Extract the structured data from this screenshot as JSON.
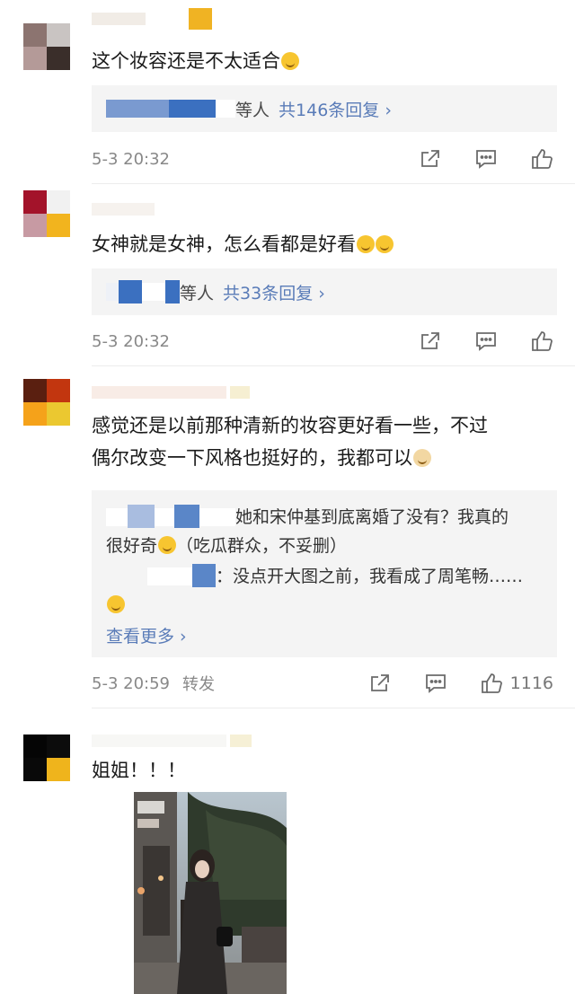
{
  "comments": [
    {
      "text": "这个妆容还是不太适合",
      "reply_suffix": "等人",
      "reply_link": "共146条回复 ›",
      "time": "5-3 20:32"
    },
    {
      "text": "女神就是女神，怎么看都是好看",
      "reply_suffix": "等人",
      "reply_link": "共33条回复 ›",
      "time": "5-3 20:32"
    },
    {
      "text_line1": "感觉还是以前那种清新的妆容更好看一些，不过",
      "text_line2": "偶尔改变一下风格也挺好的，我都可以",
      "reply1_line1": "她和宋仲基到底离婚了没有？我真的",
      "reply1_line2a": "很好奇",
      "reply1_line2b": "（吃瓜群众，不妥删）",
      "reply2": "：没点开大图之前，我看成了周笔畅……",
      "more": "查看更多 ›",
      "time": "5-3 20:59",
      "forward": "转发",
      "likes": "1116"
    },
    {
      "text": "姐姐！！！"
    }
  ],
  "icons": {
    "share": "share-icon",
    "comment": "comment-icon",
    "like": "thumbs-up-icon"
  },
  "colors": {
    "link": "#5a7cb8",
    "meta": "#888888",
    "reply_box": "#f4f4f4"
  }
}
